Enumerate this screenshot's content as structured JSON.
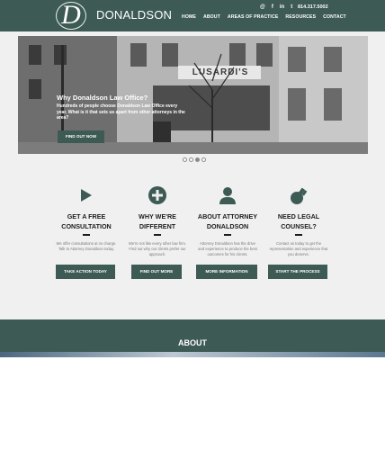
{
  "header": {
    "logo_letter": "D",
    "logo_name": "DONALDSON",
    "social_icons": [
      "blog-icon",
      "facebook-icon",
      "linkedin-icon",
      "twitter-icon"
    ],
    "social_glyphs": [
      "@",
      "f",
      "in",
      "t"
    ],
    "phone": "814.317.5002",
    "nav": [
      "HOME",
      "ABOUT",
      "AREAS OF PRACTICE",
      "RESOURCES",
      "CONTACT"
    ]
  },
  "slider": {
    "storefront_sign": "LUSARDI'S",
    "caption_title": "Why Donaldson Law Office?",
    "caption_body": "Hundreds of people choose Donaldson Law Office every year. What is it that sets us apart from other attorneys in the area?",
    "button": "FIND OUT NOW",
    "slides": 4,
    "active_slide": 3
  },
  "features": [
    {
      "icon": "play-icon",
      "title_line1": "GET A FREE",
      "title_line2": "CONSULTATION",
      "text": "We offer consultations at no charge. Talk to Attorney Donaldson today.",
      "button": "TAKE ACTION TODAY"
    },
    {
      "icon": "plus-icon",
      "title_line1": "WHY WE'RE",
      "title_line2": "DIFFERENT",
      "text": "We're not like every other law firm. Find out why our clients prefer our approach.",
      "button": "FIND OUT MORE"
    },
    {
      "icon": "person-icon",
      "title_line1": "ABOUT ATTORNEY",
      "title_line2": "DONALDSON",
      "text": "Attorney Donaldson has the drive and experience to produce the best outcomes for his clients.",
      "button": "MORE INFORMATION"
    },
    {
      "icon": "gavel-icon",
      "title_line1": "NEED LEGAL",
      "title_line2": "COUNSEL?",
      "text": "Contact us today to get the representation and experience that you deserve.",
      "button": "START THE PROCESS"
    }
  ],
  "about": {
    "title": "ABOUT"
  },
  "colors": {
    "brand": "#3d5a54",
    "band": "#f0f0f0"
  }
}
